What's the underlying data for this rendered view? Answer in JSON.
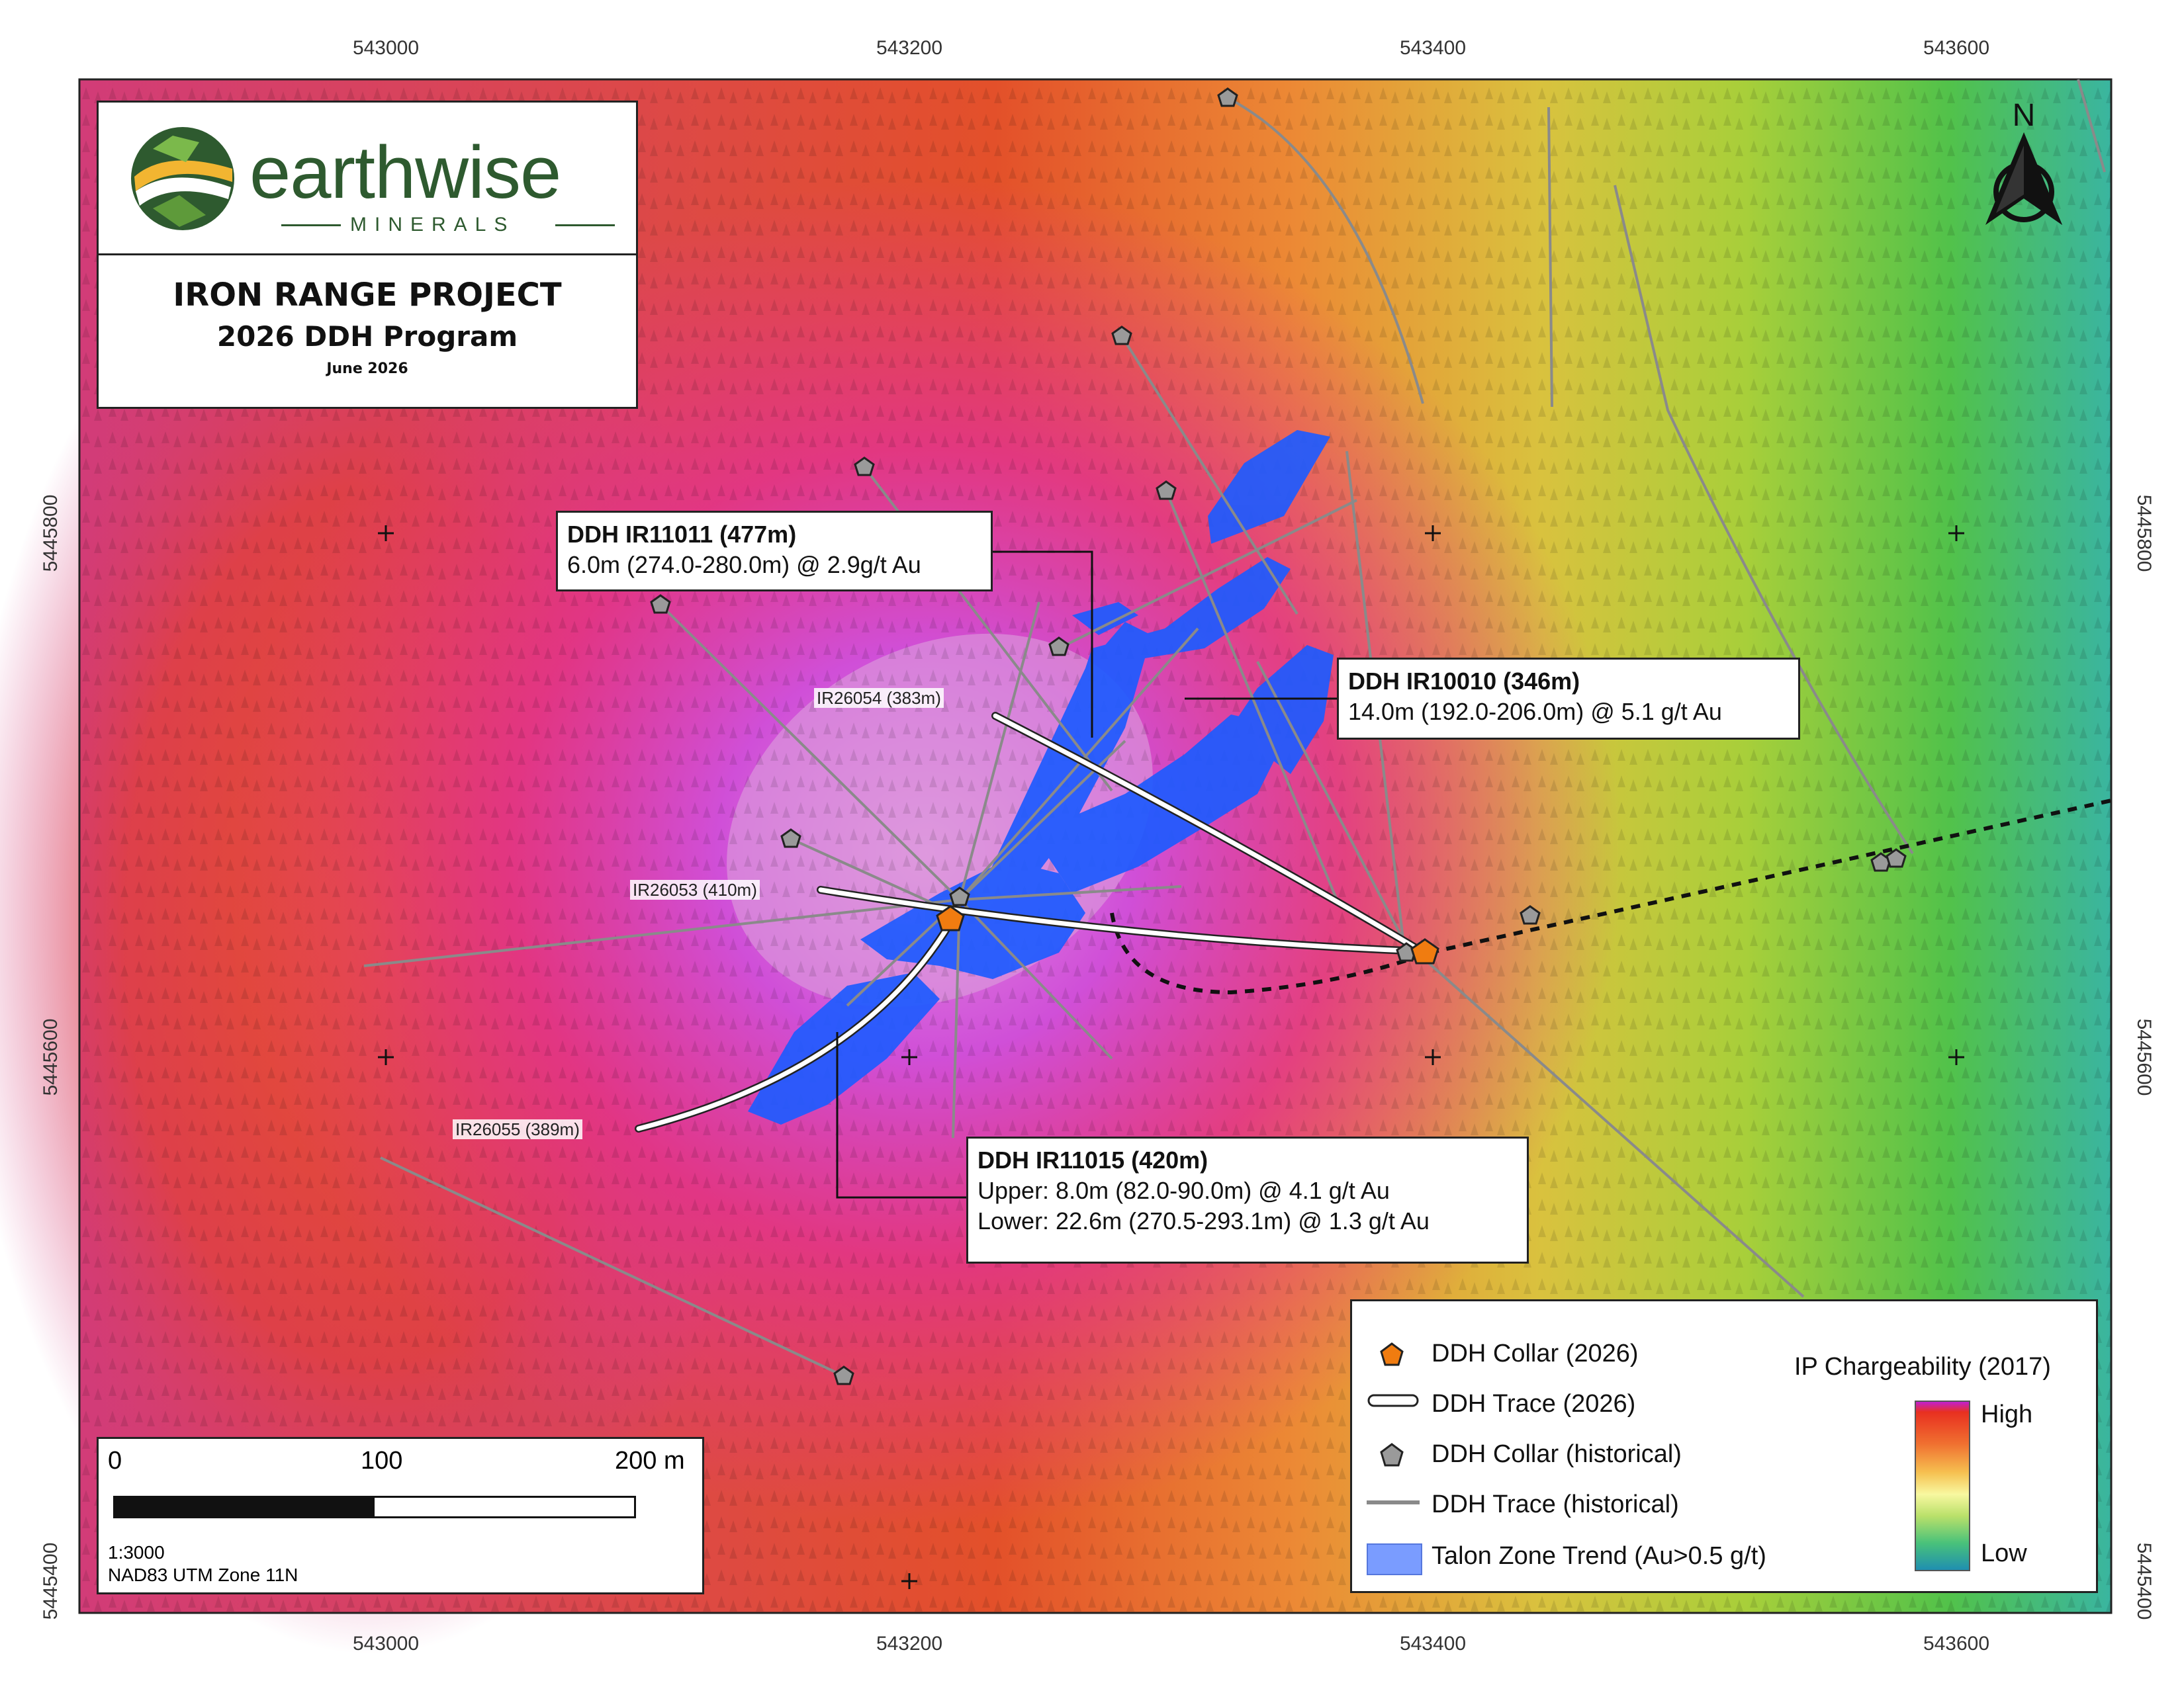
{
  "logo": {
    "name": "earthwise",
    "subtitle": "MINERALS"
  },
  "title": {
    "project": "IRON RANGE PROJECT",
    "program": "2026 DDH Program",
    "date": "June 2026"
  },
  "grid": {
    "x_labels": [
      "543000",
      "543200",
      "543400",
      "543600"
    ],
    "y_labels": [
      "5445800",
      "5445600",
      "5445400"
    ]
  },
  "north_arrow": {
    "label": "N"
  },
  "callouts": {
    "ir11011": {
      "title": "DDH IR11011 (477m)",
      "lines": [
        "6.0m (274.0-280.0m) @ 2.9g/t Au"
      ]
    },
    "ir10010": {
      "title": "DDH IR10010 (346m)",
      "lines": [
        "14.0m (192.0-206.0m) @ 5.1 g/t Au"
      ]
    },
    "ir11015": {
      "title": "DDH IR11015 (420m)",
      "lines": [
        "Upper: 8.0m (82.0-90.0m) @ 4.1 g/t Au",
        "Lower: 22.6m (270.5-293.1m) @ 1.3 g/t Au"
      ]
    }
  },
  "planned_holes": [
    "IR26054 (383m)",
    "IR26053 (410m)",
    "IR26055 (389m)"
  ],
  "scale_bar": {
    "labels": [
      "0",
      "100",
      "200 m"
    ],
    "ratio": "1:3000",
    "datum": "NAD83 UTM Zone 11N"
  },
  "legend": {
    "collar_2026": "DDH Collar (2026)",
    "trace_2026": "DDH Trace (2026)",
    "collar_hist": "DDH Collar (historical)",
    "trace_hist": "DDH Trace (historical)",
    "talon": "Talon Zone Trend (Au>0.5 g/t)",
    "ip_title": "IP Chargeability (2017)",
    "ip_high": "High",
    "ip_low": "Low"
  },
  "colors": {
    "collar_2026": "#f07c10",
    "collar_hist": "#9a9a9a",
    "talon": "#1e5bff",
    "trace_hist": "#8a8a8a"
  }
}
